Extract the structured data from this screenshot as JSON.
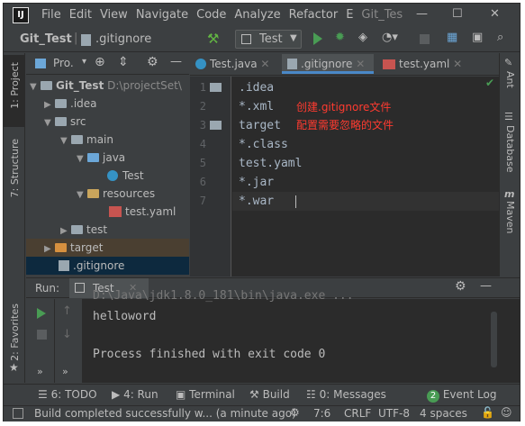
{
  "app": {
    "logo": "IJ",
    "menu": [
      "File",
      "Edit",
      "View",
      "Navigate",
      "Code",
      "Analyze",
      "Refactor",
      "E",
      "Git_Tes"
    ],
    "window_controls": [
      "—",
      "☐",
      "✕"
    ]
  },
  "toolbar": {
    "breadcrumb_project": "Git_Test",
    "breadcrumb_file": ".gitignore",
    "run_config": "Test"
  },
  "project_panel": {
    "title": "Pro.",
    "side_tabs": [
      "1: Project",
      "7: Structure",
      "2: Favorites"
    ],
    "tree": [
      {
        "label": "Git_Test",
        "extra": "D:\\projectSet\\",
        "indent": 0
      },
      {
        "label": ".idea",
        "indent": 1
      },
      {
        "label": "src",
        "indent": 1
      },
      {
        "label": "main",
        "indent": 2
      },
      {
        "label": "java",
        "indent": 3
      },
      {
        "label": "Test",
        "indent": 4
      },
      {
        "label": "resources",
        "indent": 3
      },
      {
        "label": "test.yaml",
        "indent": 4
      },
      {
        "label": "test",
        "indent": 2
      },
      {
        "label": "target",
        "indent": 1
      },
      {
        "label": ".gitignore",
        "indent": 1
      }
    ]
  },
  "editor": {
    "tabs": [
      {
        "label": "Test.java",
        "active": false
      },
      {
        "label": ".gitignore",
        "active": true
      },
      {
        "label": "test.yaml",
        "active": false
      }
    ],
    "line_numbers": [
      "1",
      "2",
      "3",
      "4",
      "5",
      "6",
      "7"
    ],
    "lines": [
      ".idea",
      "*.xml",
      "target",
      "*.class",
      "test.yaml",
      "*.jar",
      "*.war"
    ],
    "annotation_line1": "创建.gitignore文件",
    "annotation_line2": "配置需要忽略的文件"
  },
  "right_tabs": [
    "Ant",
    "Database",
    "Maven"
  ],
  "run_panel": {
    "label": "Run:",
    "tab": "Test",
    "output": [
      "D:\\Java\\jdk1.8.0_181\\bin\\java.exe ...",
      "helloword",
      "",
      "Process finished with exit code 0"
    ]
  },
  "bottom_tabs": [
    {
      "label": "6: TODO",
      "icon": "todo-icon"
    },
    {
      "label": "4: Run",
      "icon": "run-icon"
    },
    {
      "label": "Terminal",
      "icon": "terminal-icon"
    },
    {
      "label": "Build",
      "icon": "build-icon"
    },
    {
      "label": "0: Messages",
      "icon": "messages-icon"
    },
    {
      "label": "Event Log",
      "icon": "event-log-icon",
      "badge": "2"
    }
  ],
  "status_bar": {
    "message": "Build completed successfully w... (a minute ago)",
    "position": "7:6",
    "line_sep": "CRLF",
    "encoding": "UTF-8",
    "indent": "4 spaces"
  },
  "colors": {
    "background": "#3c3f41",
    "editor_bg": "#2b2b2b",
    "annotation": "#ff3b30",
    "green": "#499c54"
  }
}
